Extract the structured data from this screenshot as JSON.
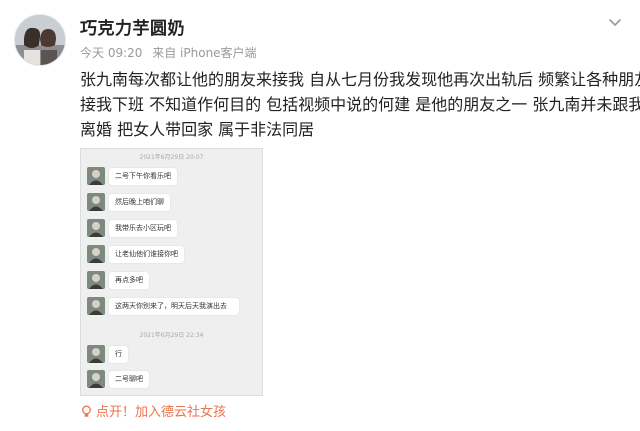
{
  "post": {
    "username": "巧克力芋圆奶",
    "time": "今天 09:20",
    "source": "来自 iPhone客户端",
    "content_lines": [
      "张九南每次都让他的朋友来接我 自从七月份我发现他再次出轨后 频繁让各种朋友",
      "接我下班 不知道作何目的 包括视频中说的何建 是他的朋友之一 张九南并未跟我",
      "离婚 把女人带回家 属于非法同居"
    ],
    "footer_link": "点开！加入德云社女孩",
    "icons": {
      "avatar": "avatar-photo",
      "menu": "chevron-down-icon",
      "footer": "lightbulb-icon"
    },
    "accent_color": "#eb7350"
  },
  "chat": {
    "timestamp1": "2021年6月29日 20:07",
    "timestamp2": "2021年6月29日 22:34",
    "messages": [
      "二号下午你看乐吧",
      "然后晚上咱们聊",
      "我带乐去小区玩吧",
      "让老仙他们谁接你吧",
      "再点多吧",
      "这两天你别来了，明天后天我演出去",
      "行",
      "二号聊吧"
    ]
  }
}
